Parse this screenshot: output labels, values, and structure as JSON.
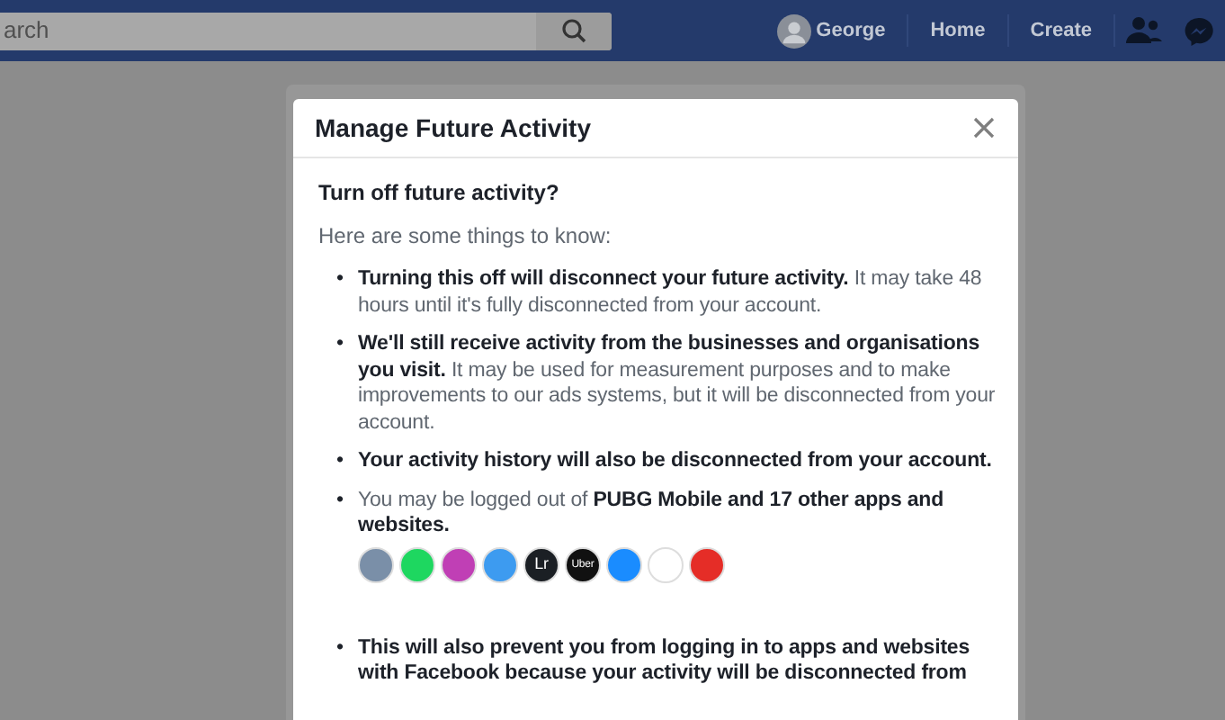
{
  "topbar": {
    "search": {
      "placeholder": "arch"
    },
    "user": "George",
    "links": [
      "Home",
      "Create"
    ]
  },
  "dialog": {
    "title": "Manage Future Activity",
    "heading": "Turn off future activity?",
    "intro": "Here are some things to know:",
    "items": [
      {
        "kind": "text",
        "bullet": "•",
        "text": "**Turning this off will disconnect your future activity.** It may take 48 hours until it's fully disconnected from your account."
      },
      {
        "kind": "text",
        "bullet": "•",
        "text": "**We'll still receive activity from the businesses and organisations you visit.** It may be used for measurement purposes and to make improvements to our ads systems, but it will be disconnected from your account."
      },
      {
        "kind": "text",
        "bullet": "•",
        "text": "**Your activity history will also be disconnected from your account.**"
      },
      {
        "kind": "apps",
        "bullet": "•",
        "text": "You may be logged out of **PUBG Mobile and 17 other apps and websites.**",
        "apps": [
          {
            "color": "#7a8fa8"
          },
          {
            "color": "#1ed760"
          },
          {
            "color": "#c03fb5"
          },
          {
            "color": "#3d9bf0"
          },
          {
            "color": "#1b1f24",
            "label": "Lr"
          },
          {
            "color": "#111111",
            "label": "Uber"
          },
          {
            "color": "#1a8cff"
          },
          {
            "color": "#ffffff"
          },
          {
            "color": "#e52d27"
          }
        ]
      },
      {
        "kind": "text",
        "bullet": "•",
        "text": "**This will also prevent you from logging in to apps and websites with Facebook because your activity will be disconnected from**"
      }
    ]
  }
}
